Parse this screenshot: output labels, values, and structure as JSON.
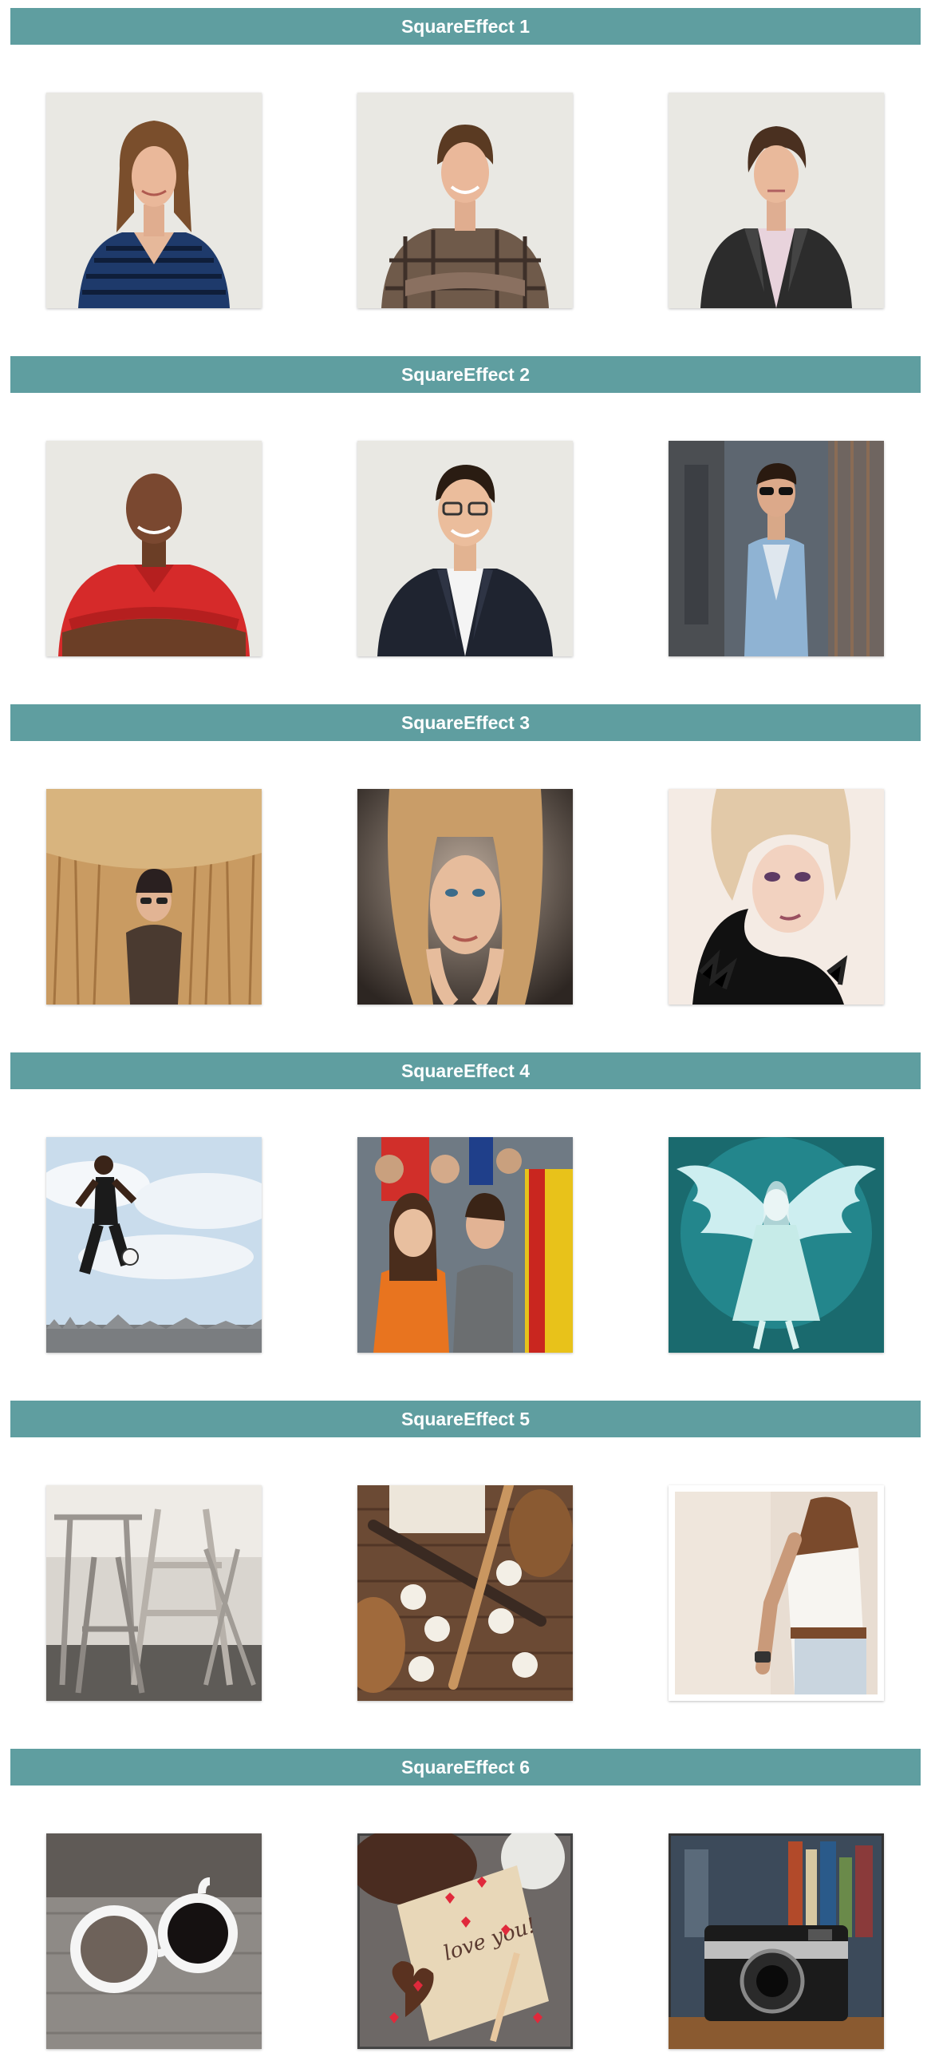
{
  "sections": [
    {
      "title": "SquareEffect 1"
    },
    {
      "title": "SquareEffect 2"
    },
    {
      "title": "SquareEffect 3"
    },
    {
      "title": "SquareEffect 4"
    },
    {
      "title": "SquareEffect 5"
    },
    {
      "title": "SquareEffect 6"
    }
  ],
  "photo_note": {
    "text": "love you!"
  },
  "colors": {
    "section_bar": "#5f9ea0",
    "section_text": "#ffffff",
    "page_background": "#ffffff"
  }
}
